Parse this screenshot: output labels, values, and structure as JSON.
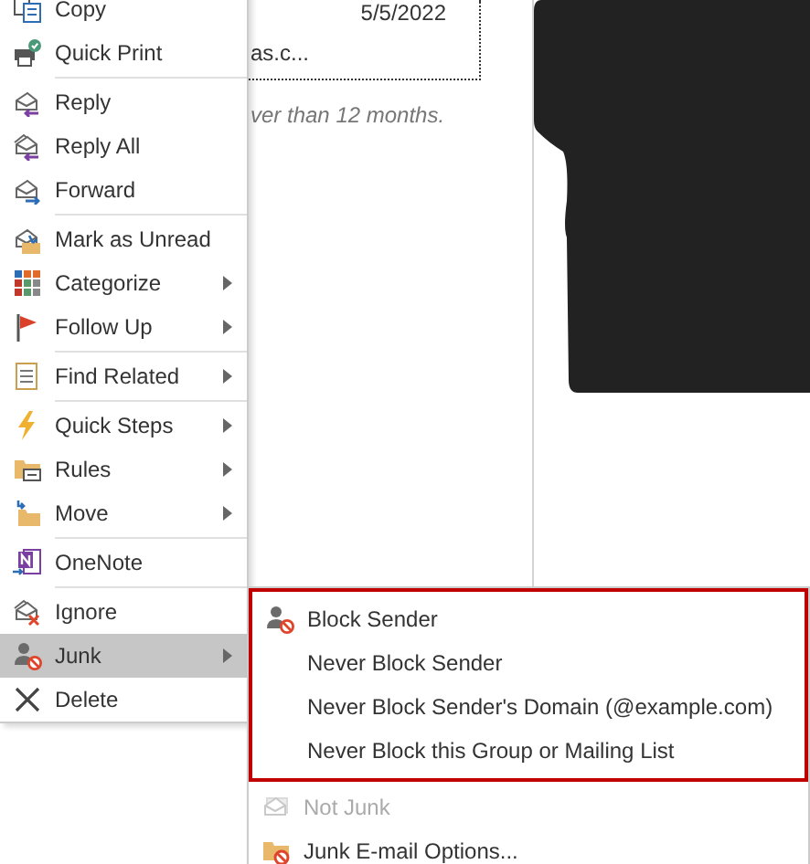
{
  "message_list": {
    "date": "5/5/2022",
    "preview": "as.c...",
    "note": "ver than 12 months."
  },
  "context_menu": {
    "groups": [
      [
        {
          "label": "Copy",
          "submenu": false,
          "selected": false
        },
        {
          "label": "Quick Print",
          "submenu": false,
          "selected": false
        }
      ],
      [
        {
          "label": "Reply",
          "submenu": false,
          "selected": false
        },
        {
          "label": "Reply All",
          "submenu": false,
          "selected": false
        },
        {
          "label": "Forward",
          "submenu": false,
          "selected": false
        }
      ],
      [
        {
          "label": "Mark as Unread",
          "submenu": false,
          "selected": false
        },
        {
          "label": "Categorize",
          "submenu": true,
          "selected": false
        },
        {
          "label": "Follow Up",
          "submenu": true,
          "selected": false
        }
      ],
      [
        {
          "label": "Find Related",
          "submenu": true,
          "selected": false
        }
      ],
      [
        {
          "label": "Quick Steps",
          "submenu": true,
          "selected": false
        },
        {
          "label": "Rules",
          "submenu": true,
          "selected": false
        },
        {
          "label": "Move",
          "submenu": true,
          "selected": false
        }
      ],
      [
        {
          "label": "OneNote",
          "submenu": false,
          "selected": false
        }
      ],
      [
        {
          "label": "Ignore",
          "submenu": false,
          "selected": false
        },
        {
          "label": "Junk",
          "submenu": true,
          "selected": true
        },
        {
          "label": "Delete",
          "submenu": false,
          "selected": false
        }
      ]
    ]
  },
  "junk_submenu": {
    "highlighted_items": [
      {
        "label": "Block Sender",
        "disabled": false
      },
      {
        "label": "Never Block Sender",
        "disabled": false
      },
      {
        "label": "Never Block Sender's Domain (@example.com)",
        "disabled": false
      },
      {
        "label": "Never Block this Group or Mailing List",
        "disabled": false
      }
    ],
    "items": [
      {
        "label": "Not Junk",
        "disabled": true
      },
      {
        "label": "Junk E-mail Options...",
        "disabled": false
      }
    ]
  }
}
